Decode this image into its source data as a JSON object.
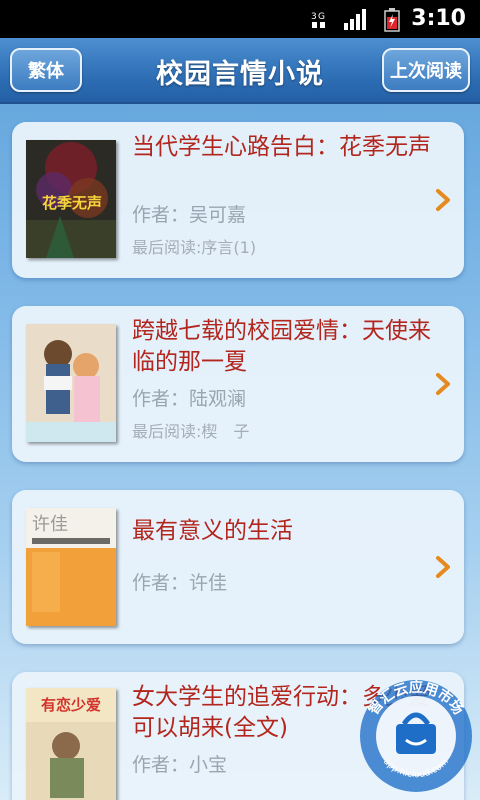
{
  "status_bar": {
    "time": "3:10",
    "network_icon": "data-3g-icon",
    "signal_icon": "signal-icon",
    "battery_icon": "battery-charging-icon"
  },
  "header": {
    "left_button": "繁体",
    "title": "校园言情小说",
    "right_button": "上次阅读"
  },
  "books": [
    {
      "title": "当代学生心路告白：花季无声",
      "author": "作者：吴可嘉",
      "last_read": "最后阅读:序言(1)",
      "cover_text": "花季无声"
    },
    {
      "title": "跨越七载的校园爱情：天使来临的那一夏",
      "author": "作者：陆观澜",
      "last_read": "最后阅读:楔　子",
      "cover_text": ""
    },
    {
      "title": "最有意义的生活",
      "author": "作者：许佳",
      "last_read": "",
      "cover_text": "许佳"
    },
    {
      "title": "女大学生的追爱行动：多少爱可以胡来(全文)",
      "author": "作者：小宝",
      "last_read": "",
      "cover_text": "有恋少爱"
    }
  ],
  "watermark": {
    "text": "智汇云应用市场",
    "url_text": "app.hicloud.com"
  },
  "colors": {
    "title_red": "#b3261e",
    "header_blue": "#2e6fb6",
    "chevron_orange": "#e58a1f"
  }
}
